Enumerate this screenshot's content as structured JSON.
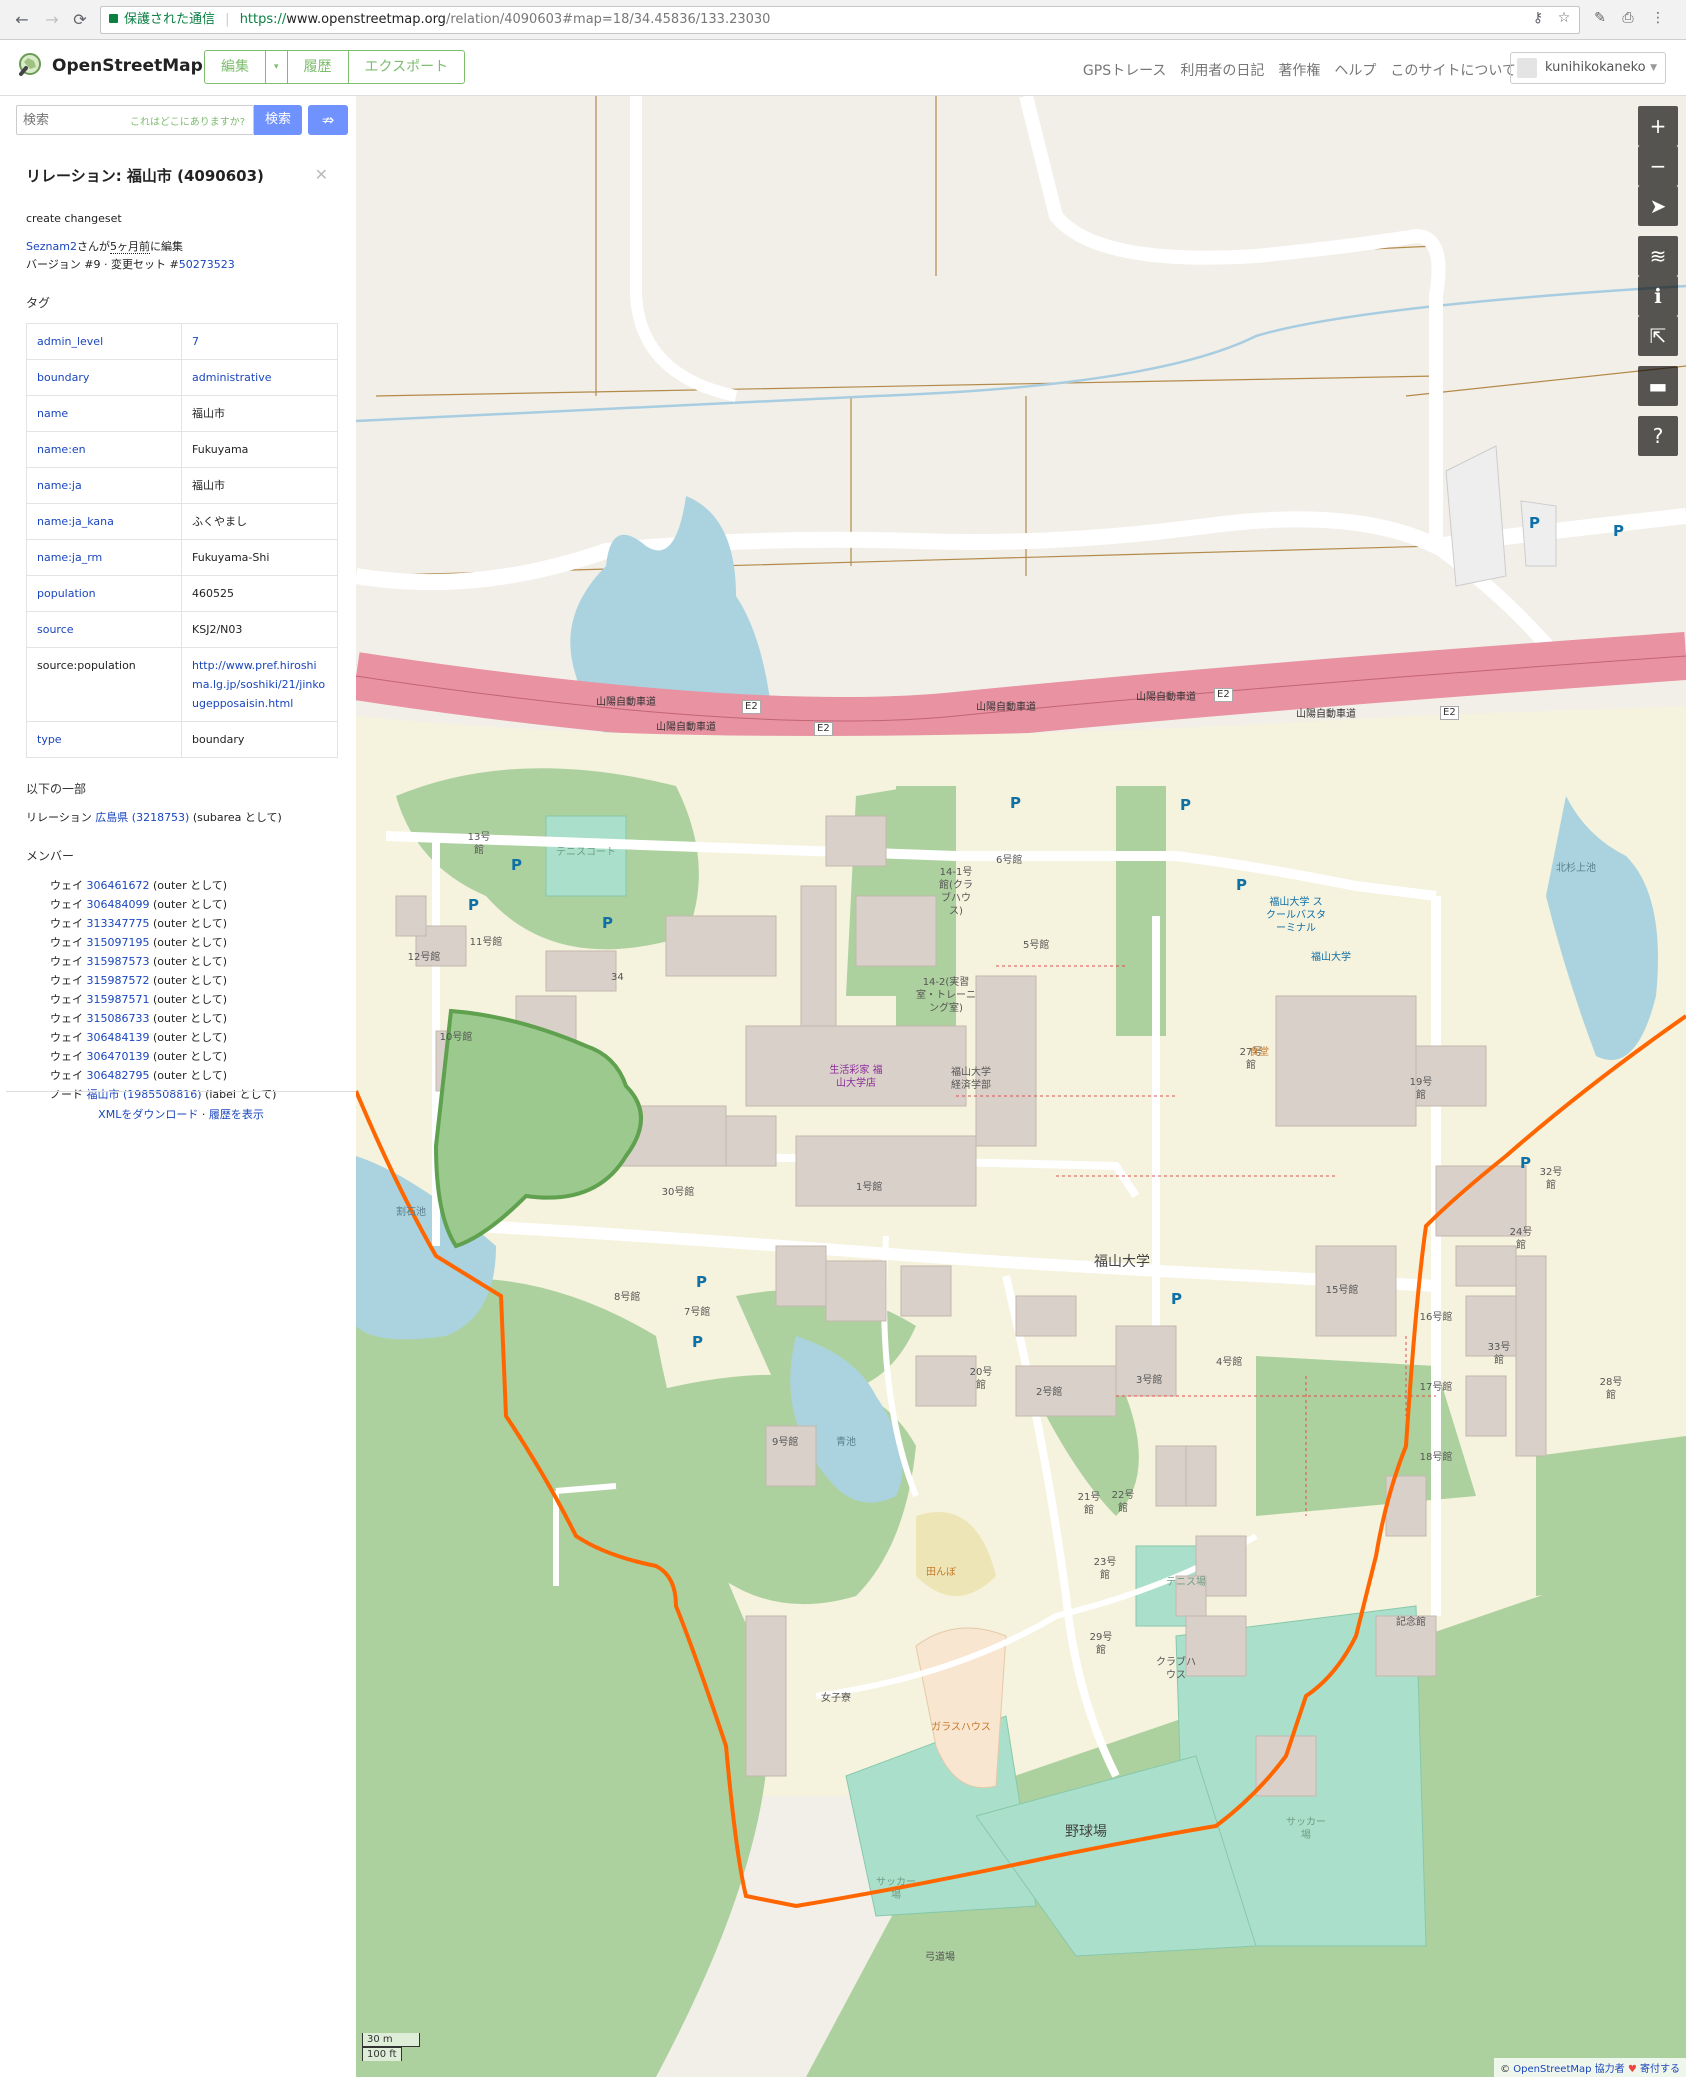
{
  "browser": {
    "secure_label": "保護された通信",
    "url_scheme": "https://",
    "url_host": "www.openstreetmap.org",
    "url_path": "/relation/4090603#map=18/34.45836/133.23030"
  },
  "header": {
    "site_name": "OpenStreetMap",
    "tabs": [
      "編集",
      "▾",
      "履歴",
      "エクスポート"
    ],
    "nav": [
      "GPSトレース",
      "利用者の日記",
      "著作権",
      "ヘルプ",
      "このサイトについて"
    ],
    "username": "kunihikokaneko"
  },
  "search": {
    "placeholder": "検索",
    "hint": "これはどこにありますか?",
    "button": "検索",
    "directions_icon": "directions-icon"
  },
  "relation": {
    "title": "リレーション: 福山市 (4090603)",
    "comment": "create changeset",
    "editor": "Seznam2",
    "edited_suffix_a": "さんが",
    "edited_ago": "5ヶ月前",
    "edited_suffix_b": "に編集",
    "version_text": "バージョン #9 · 変更セット #",
    "changeset": "50273523"
  },
  "tags": {
    "heading": "タグ",
    "rows": [
      {
        "k": "admin_level",
        "v": "7",
        "klink": true,
        "vlink": true
      },
      {
        "k": "boundary",
        "v": "administrative",
        "klink": true,
        "vlink": true
      },
      {
        "k": "name",
        "v": "福山市",
        "klink": true,
        "vlink": false
      },
      {
        "k": "name:en",
        "v": "Fukuyama",
        "klink": true,
        "vlink": false
      },
      {
        "k": "name:ja",
        "v": "福山市",
        "klink": true,
        "vlink": false
      },
      {
        "k": "name:ja_kana",
        "v": "ふくやまし",
        "klink": true,
        "vlink": false
      },
      {
        "k": "name:ja_rm",
        "v": "Fukuyama-Shi",
        "klink": true,
        "vlink": false
      },
      {
        "k": "population",
        "v": "460525",
        "klink": true,
        "vlink": false
      },
      {
        "k": "source",
        "v": "KSJ2/N03",
        "klink": true,
        "vlink": false
      },
      {
        "k": "source:population",
        "v": "http://www.pref.hiroshima.lg.jp/soshiki/21/jinkougepposaisin.html",
        "klink": false,
        "vlink": true
      },
      {
        "k": "type",
        "v": "boundary",
        "klink": true,
        "vlink": false
      }
    ]
  },
  "part_of": {
    "heading": "以下の一部",
    "prefix": "リレーション ",
    "link": "広島県 (3218753)",
    "suffix": " (subarea として)"
  },
  "members": {
    "heading": "メンバー",
    "items": [
      {
        "type": "ウェイ ",
        "id": "306461672",
        "role": " (outer として)"
      },
      {
        "type": "ウェイ ",
        "id": "306484099",
        "role": " (outer として)"
      },
      {
        "type": "ウェイ ",
        "id": "313347775",
        "role": " (outer として)"
      },
      {
        "type": "ウェイ ",
        "id": "315097195",
        "role": " (outer として)"
      },
      {
        "type": "ウェイ ",
        "id": "315987573",
        "role": " (outer として)"
      },
      {
        "type": "ウェイ ",
        "id": "315987572",
        "role": " (outer として)"
      },
      {
        "type": "ウェイ ",
        "id": "315987571",
        "role": " (outer として)"
      },
      {
        "type": "ウェイ ",
        "id": "315086733",
        "role": " (outer として)"
      },
      {
        "type": "ウェイ ",
        "id": "306484139",
        "role": " (outer として)"
      },
      {
        "type": "ウェイ ",
        "id": "306470139",
        "role": " (outer として)"
      },
      {
        "type": "ウェイ ",
        "id": "306482795",
        "role": " (outer として)"
      },
      {
        "type": "ノード ",
        "id": "福山市 (1985508816)",
        "role": " (label として)"
      }
    ]
  },
  "footer": {
    "xml": "XMLをダウンロード",
    "sep": " · ",
    "history": "履歴を表示"
  },
  "map": {
    "labels": {
      "sanyo_expressway": "山陽自動車道",
      "e2": "E2",
      "fukuyama_univ": "福山大学",
      "bldg_1": "1号館",
      "bldg_2": "2号館",
      "bldg_3": "3号館",
      "bldg_4": "4号館",
      "bldg_5": "5号館",
      "bldg_6": "6号館",
      "bldg_7": "7号館",
      "bldg_8": "8号館",
      "bldg_9": "9号館",
      "bldg_10": "10号館",
      "bldg_11": "11号館",
      "bldg_12": "12号館",
      "bldg_13": "13号館",
      "bldg_14_1": "14-1号館(クラブハウス)",
      "bldg_14_2": "14-2(実習室・トレーニング室)",
      "bldg_15": "15号館",
      "bldg_16": "16号館",
      "bldg_17": "17号館",
      "bldg_18": "18号館",
      "bldg_19": "19号館",
      "bldg_20": "20号館",
      "bldg_21": "21号館",
      "bldg_22": "22号館",
      "bldg_23": "23号館",
      "bldg_24": "24号館",
      "bldg_27": "27号館",
      "bldg_28": "28号館",
      "bldg_29": "29号館",
      "bldg_30": "30号館",
      "bldg_32": "32号館",
      "bldg_33": "33号館",
      "bldg_34": "34",
      "coop": "生活彩家 福山大学店",
      "econ": "福山大学 経済学部",
      "cafeteria": "食堂",
      "bus_terminal": "福山大学 スクールバスターミナル",
      "bus_stop": "福山大学",
      "tennis_court": "テニスコート",
      "tennis_court2": "テニス場",
      "club_house": "クラブハウス",
      "girls_dorm": "女子寮",
      "rice_field": "田んぼ",
      "glass_house": "ガラスハウス",
      "soccer1": "サッカー場",
      "soccer2": "サッカー場",
      "baseball": "野球場",
      "archery": "弓道場",
      "memorial": "記念館",
      "pond_waridashi": "割石池",
      "pond_kitasugi": "北杉上池",
      "pond_aoike": "青池",
      "p": "P",
      "scale_m": "30 m",
      "scale_ft": "100 ft"
    },
    "attribution": {
      "prefix": "© ",
      "osm": "OpenStreetMap",
      "contrib": " 協力者",
      "heart": " ♥ ",
      "donate": "寄付する"
    },
    "controls": [
      "zoom-in-icon",
      "zoom-out-icon",
      "geolocate-icon",
      "layers-icon",
      "info-icon",
      "share-icon",
      "note-icon",
      "query-icon"
    ],
    "control_glyphs": [
      "+",
      "−",
      "➤",
      "≋",
      "ℹ",
      "⇱",
      "▬",
      "?"
    ]
  }
}
